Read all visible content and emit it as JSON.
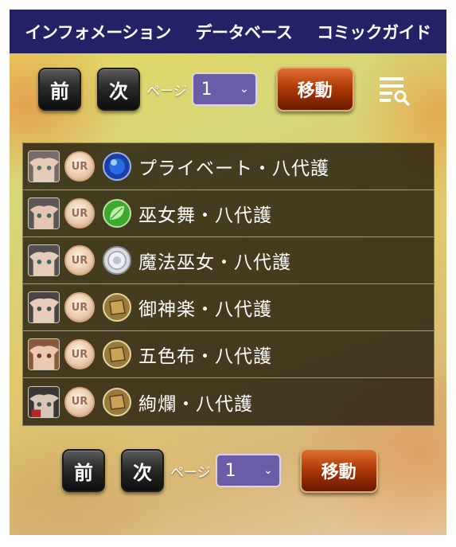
{
  "nav": {
    "items": [
      "インフォメーション",
      "データベース",
      "コミックガイド"
    ]
  },
  "pager": {
    "prev_label": "前",
    "next_label": "次",
    "page_label": "ページ",
    "page_value": "1",
    "move_label": "移動"
  },
  "list": {
    "items": [
      {
        "name": "プライベート・八代護",
        "rarity": "UR",
        "element": "water-orb-icon"
      },
      {
        "name": "巫女舞・八代護",
        "rarity": "UR",
        "element": "leaf-orb-icon"
      },
      {
        "name": "魔法巫女・八代護",
        "rarity": "UR",
        "element": "steel-orb-icon"
      },
      {
        "name": "御神楽・八代護",
        "rarity": "UR",
        "element": "earth-block-icon"
      },
      {
        "name": "五色布・八代護",
        "rarity": "UR",
        "element": "earth-block-icon"
      },
      {
        "name": "絢爛・八代護",
        "rarity": "UR",
        "element": "earth-block-icon"
      }
    ]
  },
  "colors": {
    "nav_bg": "#232266",
    "move_button": "#b03a08",
    "select_bg": "#6b5ca8",
    "row_bg": "#1e160a"
  }
}
